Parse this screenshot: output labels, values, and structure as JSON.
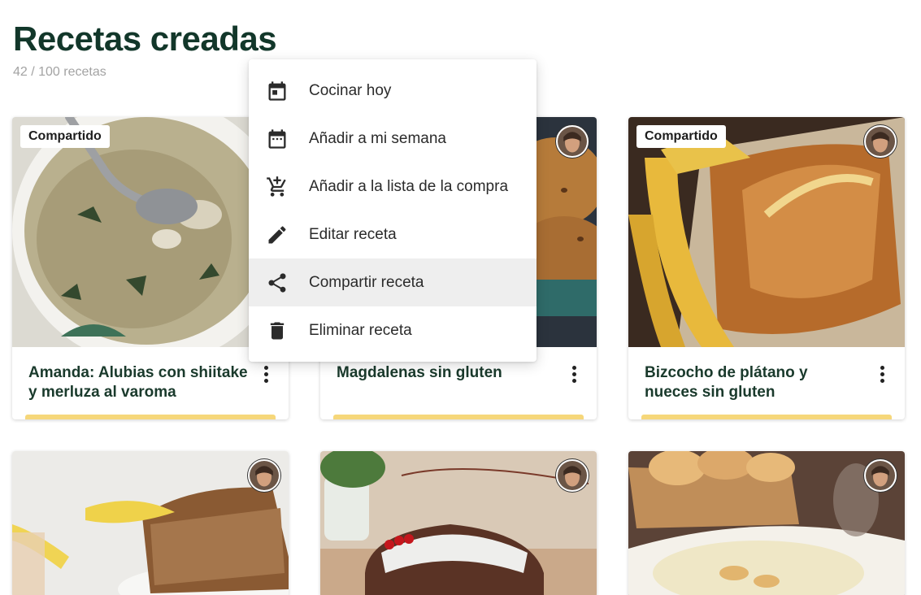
{
  "header": {
    "title": "Recetas creadas",
    "count": "42 / 100 recetas"
  },
  "context_menu": {
    "items": [
      {
        "label": "Cocinar hoy",
        "icon": "calendar-today-icon"
      },
      {
        "label": "Añadir a mi semana",
        "icon": "calendar-week-icon"
      },
      {
        "label": "Añadir a la lista de la compra",
        "icon": "add-shopping-cart-icon"
      },
      {
        "label": "Editar receta",
        "icon": "pencil-icon"
      },
      {
        "label": "Compartir receta",
        "icon": "share-icon",
        "highlighted": true
      },
      {
        "label": "Eliminar receta",
        "icon": "trash-icon"
      }
    ]
  },
  "recipes": [
    {
      "title": "Amanda: Alubias con shiitake y merluza al varoma",
      "badge": "Compartido",
      "image": "bean-soup-bowl"
    },
    {
      "title": "Magdalenas sin gluten",
      "badge": "",
      "image": "muffins"
    },
    {
      "title": "Bizcocho de plátano y nueces sin gluten",
      "badge": "Compartido",
      "image": "banana-bread-with-bananas"
    },
    {
      "title": "",
      "badge": "",
      "image": "banana-bread-slice"
    },
    {
      "title": "",
      "badge": "",
      "image": "glazed-bundt-cake"
    },
    {
      "title": "",
      "badge": "",
      "image": "cream-soup-with-bread"
    }
  ],
  "colors": {
    "title": "#12372a",
    "accent_bar": "#f6d77a",
    "menu_highlight": "#eeeeee"
  }
}
